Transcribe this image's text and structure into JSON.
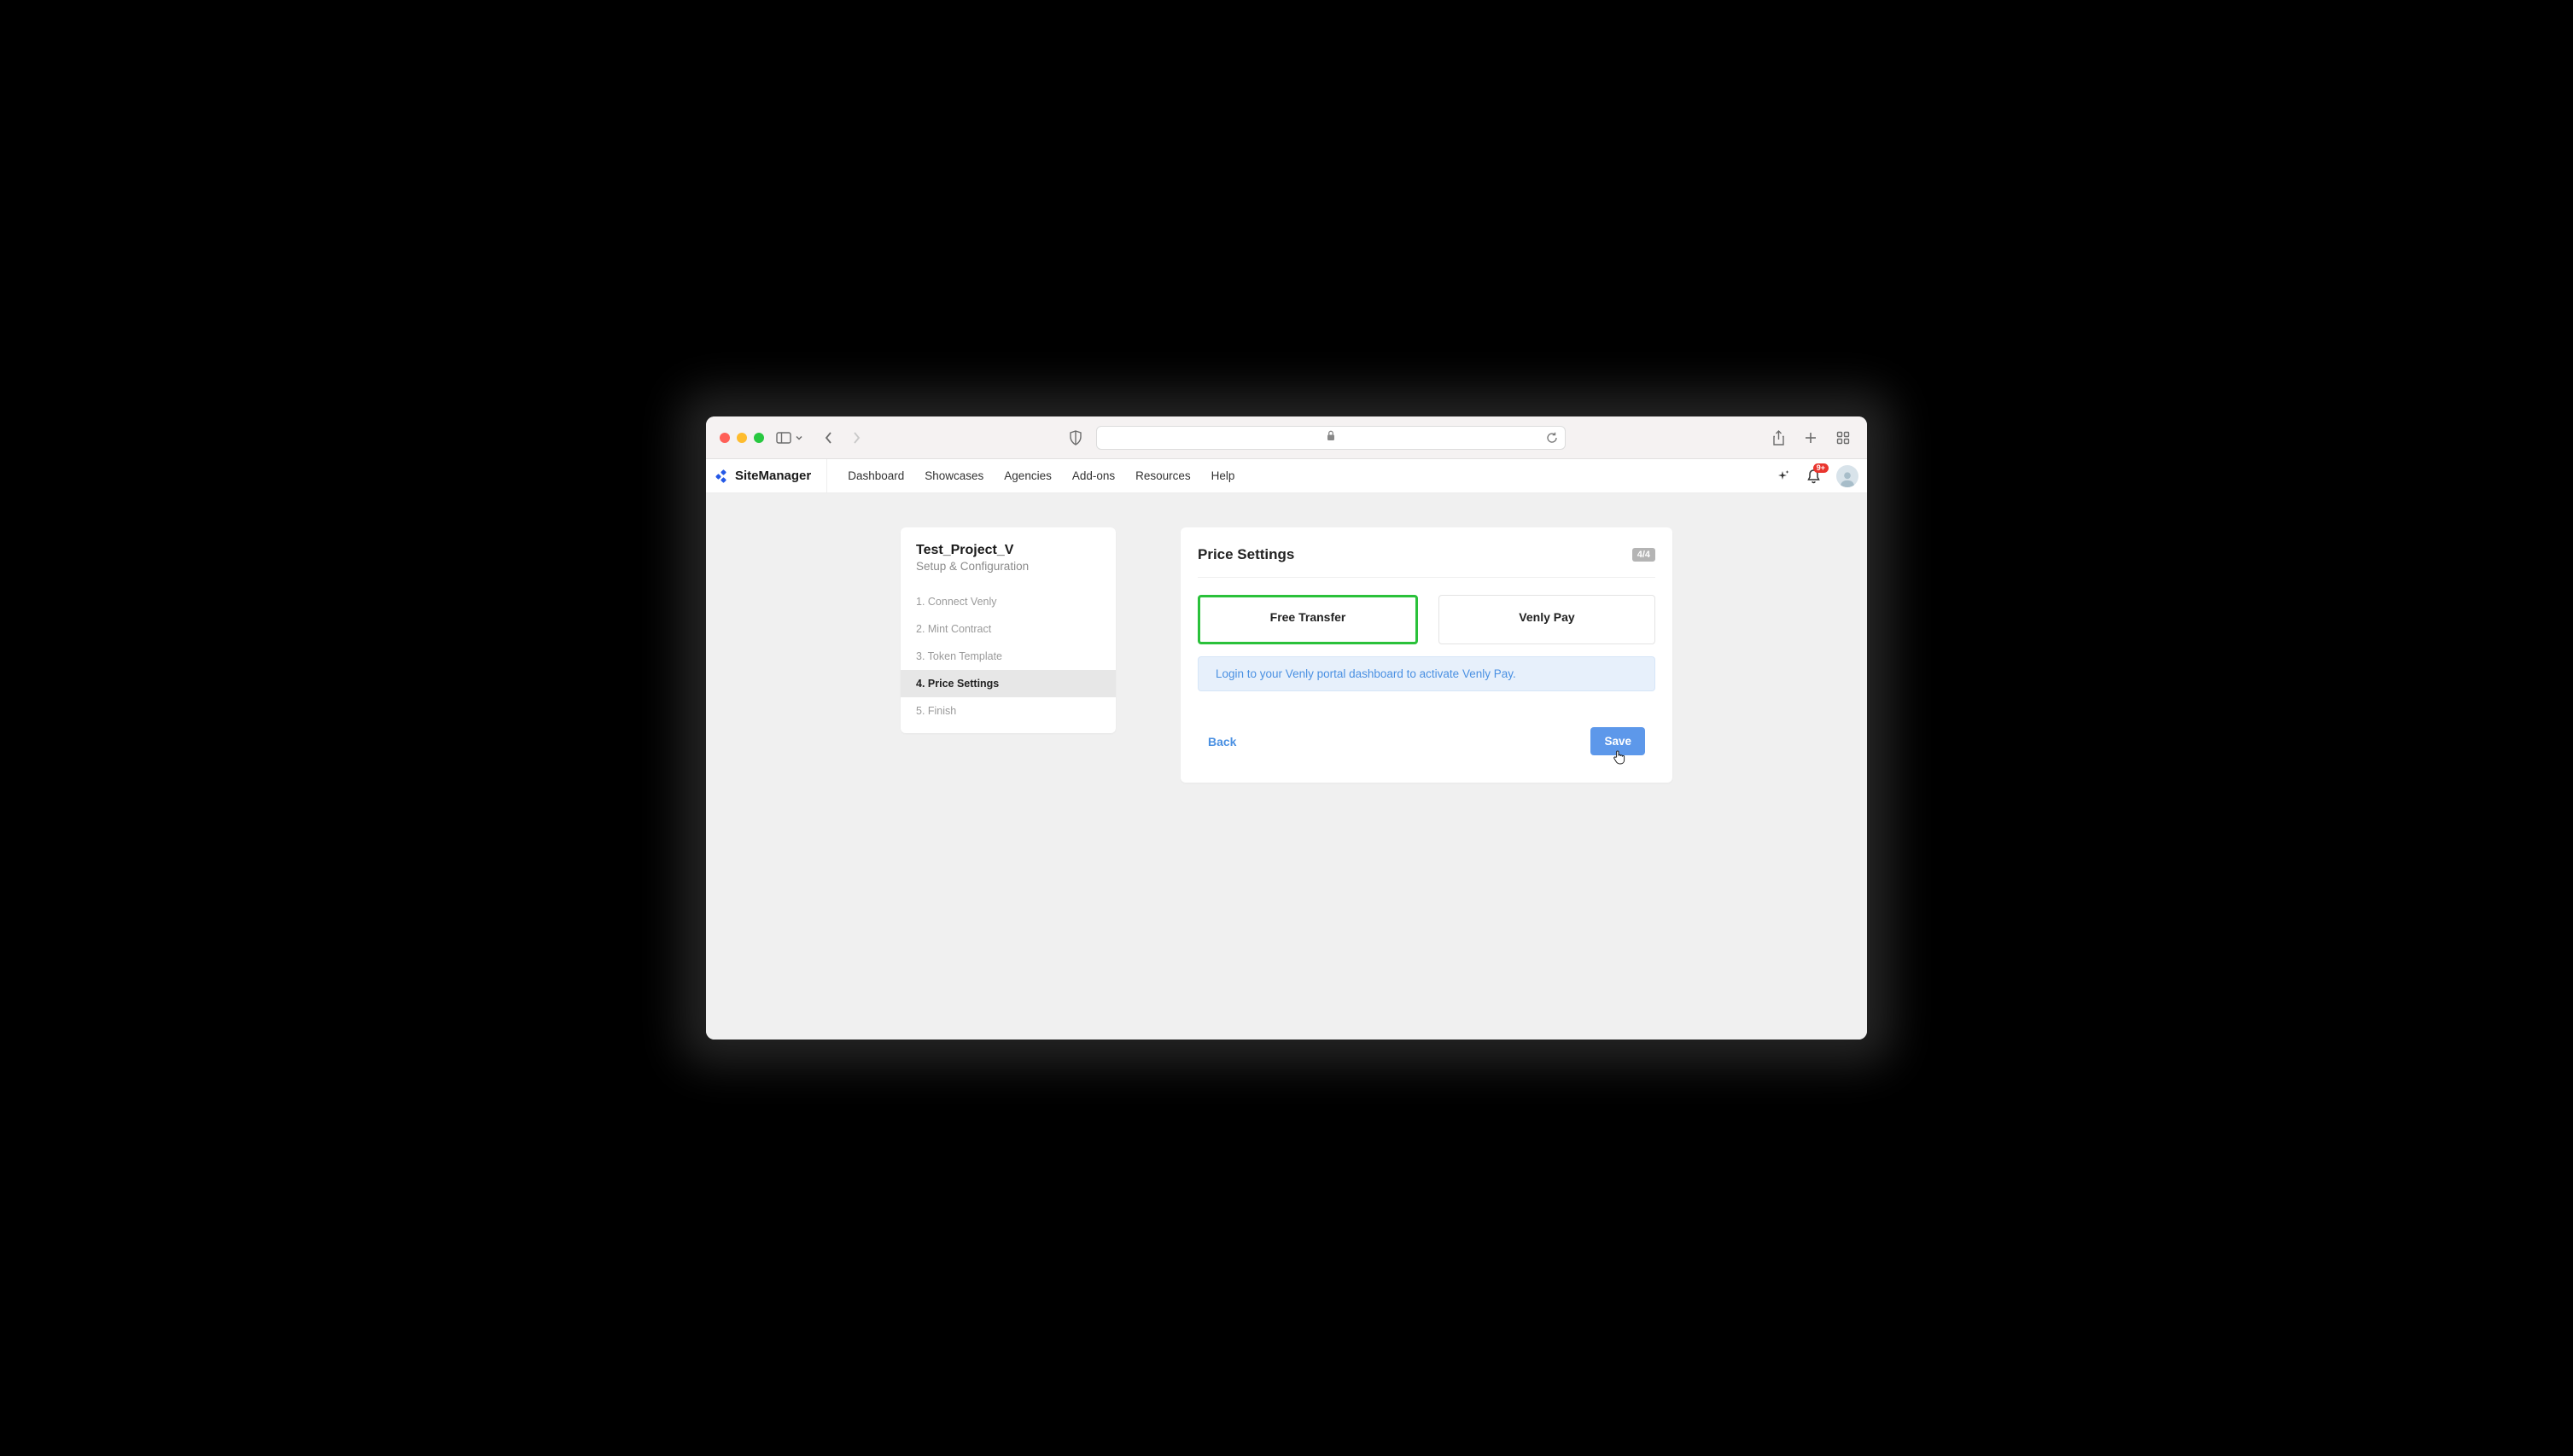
{
  "brand": {
    "name": "SiteManager"
  },
  "nav": {
    "items": [
      "Dashboard",
      "Showcases",
      "Agencies",
      "Add-ons",
      "Resources",
      "Help"
    ]
  },
  "notifications": {
    "badge": "9+"
  },
  "sidebar": {
    "title": "Test_Project_V",
    "subtitle": "Setup & Configuration",
    "steps": [
      {
        "label": "1. Connect Venly",
        "active": false
      },
      {
        "label": "2. Mint Contract",
        "active": false
      },
      {
        "label": "3. Token Template",
        "active": false
      },
      {
        "label": "4. Price Settings",
        "active": true
      },
      {
        "label": "5. Finish",
        "active": false
      }
    ]
  },
  "main": {
    "title": "Price Settings",
    "step_indicator": "4/4",
    "options": [
      {
        "label": "Free Transfer",
        "selected": true
      },
      {
        "label": "Venly Pay",
        "selected": false
      }
    ],
    "info_text": "Login to your Venly portal dashboard to activate Venly Pay.",
    "back_label": "Back",
    "save_label": "Save"
  }
}
